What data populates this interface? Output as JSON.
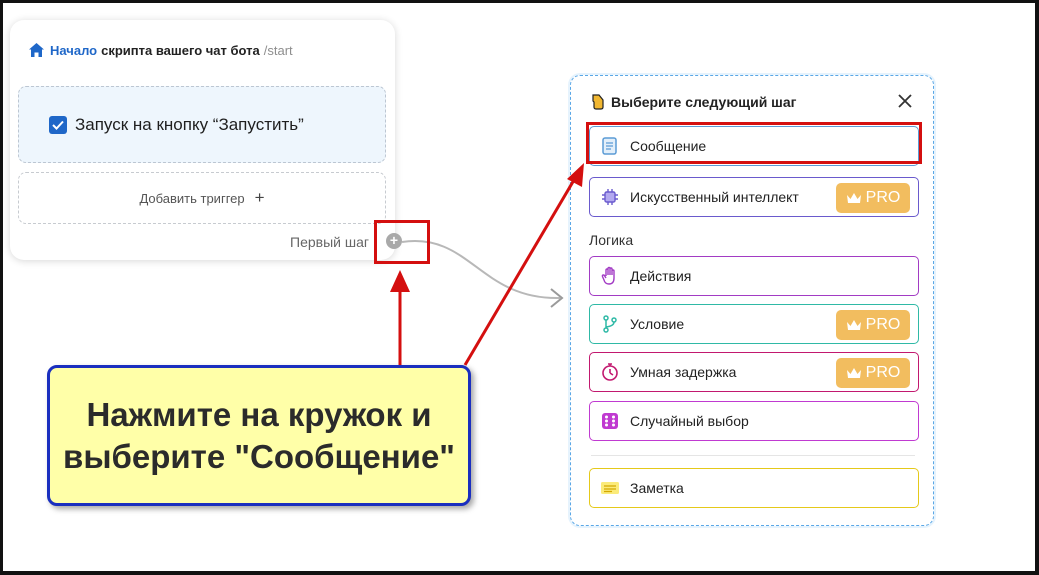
{
  "start_card": {
    "header_highlight": "Начало",
    "header_title": "скрипта вашего чат бота",
    "header_command": "/start",
    "trigger_label": "Запуск на кнопку “Запустить”",
    "add_trigger_label": "Добавить триггер",
    "add_trigger_plus": "+",
    "first_step_label": "Первый шаг",
    "step_dot": "+"
  },
  "callout": {
    "text": "Нажмите на кружок и\nвыберите \"Сообщение\""
  },
  "panel": {
    "title": "Выберите следующий шаг",
    "logic_label": "Логика",
    "pro_label": "PRO",
    "items": [
      {
        "label": "Сообщение",
        "icon": "message-doc-icon",
        "color": "#5b9bd5"
      },
      {
        "label": "Искусственный интеллект",
        "icon": "ai-chip-icon",
        "color": "#6a5acd"
      },
      {
        "label": "Действия",
        "icon": "hand-icon",
        "color": "#a23bc4"
      },
      {
        "label": "Условие",
        "icon": "branch-icon",
        "color": "#2fb9a6"
      },
      {
        "label": "Умная задержка",
        "icon": "stopwatch-icon",
        "color": "#c2186f"
      },
      {
        "label": "Случайный выбор",
        "icon": "dice-icon",
        "color": "#c03ad1"
      },
      {
        "label": "Заметка",
        "icon": "note-icon",
        "color": "#e5c91a"
      }
    ]
  },
  "colors": {
    "accent": "#1f67c8",
    "highlight_red": "#d40f0f",
    "callout_bg": "#ffffa8",
    "callout_border": "#1a2fbf",
    "pro_badge": "#f2bd5f"
  }
}
